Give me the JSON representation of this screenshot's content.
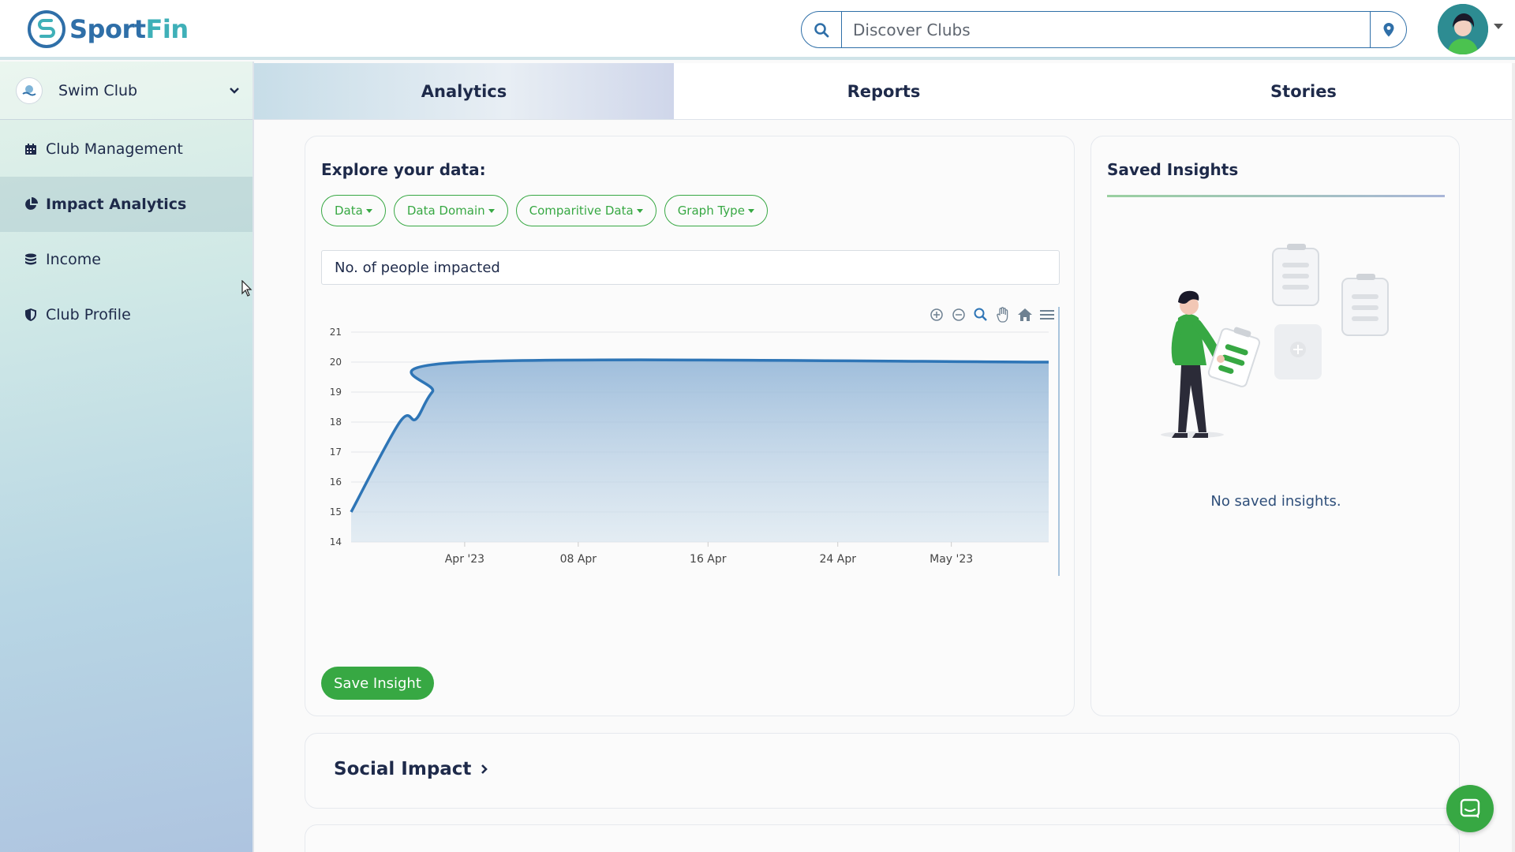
{
  "header": {
    "logo_sport": "Sport",
    "logo_fin": "Fin",
    "search_placeholder": "Discover Clubs"
  },
  "sidebar": {
    "club_name": "Swim Club",
    "items": [
      {
        "label": "Club Management",
        "icon": "calendar-icon"
      },
      {
        "label": "Impact Analytics",
        "icon": "pie-chart-icon",
        "active": true
      },
      {
        "label": "Income",
        "icon": "coins-icon"
      },
      {
        "label": "Club Profile",
        "icon": "shield-icon"
      }
    ]
  },
  "tabs": [
    {
      "label": "Analytics",
      "active": true
    },
    {
      "label": "Reports"
    },
    {
      "label": "Stories"
    }
  ],
  "explore": {
    "title": "Explore your data:",
    "filters": [
      "Data",
      "Data Domain",
      "Comparitive Data",
      "Graph Type"
    ],
    "metric_label": "No. of people impacted",
    "save_label": "Save Insight"
  },
  "chart_data": {
    "type": "area",
    "title": "",
    "xlabel": "",
    "ylabel": "",
    "x_ticks": [
      "Apr '23",
      "08 Apr",
      "16 Apr",
      "24 Apr",
      "May '23"
    ],
    "y_ticks": [
      14,
      15,
      16,
      17,
      18,
      19,
      20,
      21
    ],
    "ylim": [
      14,
      21
    ],
    "x": [
      "2023-03-25",
      "2023-03-28",
      "2023-03-29",
      "2023-03-30",
      "2023-04-01",
      "2023-05-07"
    ],
    "values": [
      15,
      18,
      18.1,
      19,
      20,
      20
    ],
    "grid": true,
    "color": "#2e75b6"
  },
  "insights": {
    "title": "Saved Insights",
    "empty_text": "No saved insights."
  },
  "social": {
    "title": "Social Impact"
  },
  "colors": {
    "brand_blue": "#2f6fa8",
    "brand_teal": "#3fb0b8",
    "accent_green": "#37a843",
    "text_navy": "#1e2a4a"
  }
}
